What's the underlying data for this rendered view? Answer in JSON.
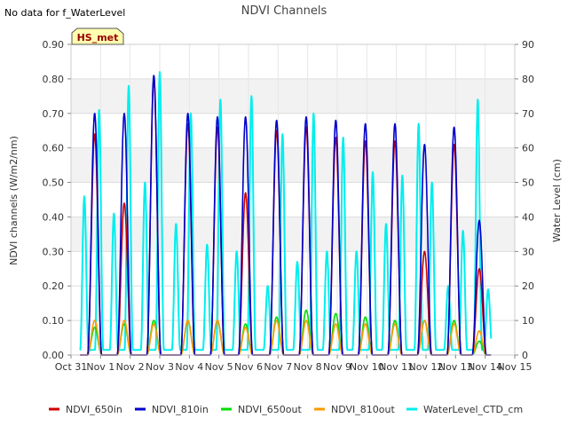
{
  "notice": "No data for f_WaterLevel",
  "site_badge": "HS_met",
  "chart_data": {
    "type": "line",
    "title": "NDVI Channels",
    "ylabel": "NDVI channels (W/m2/nm)",
    "ylabel_right": "Water Level (cm)",
    "x_ticks": [
      "Oct 31",
      "Nov 1",
      "Nov 2",
      "Nov 3",
      "Nov 4",
      "Nov 5",
      "Nov 6",
      "Nov 7",
      "Nov 8",
      "Nov 9",
      "Nov 10",
      "Nov 11",
      "Nov 12",
      "Nov 13",
      "Nov 14",
      "Nov 15"
    ],
    "xlim": [
      0,
      15
    ],
    "ylim": [
      0,
      0.9
    ],
    "y_ticks": [
      "0.00",
      "0.10",
      "0.20",
      "0.30",
      "0.40",
      "0.50",
      "0.60",
      "0.70",
      "0.80",
      "0.90"
    ],
    "ylim_right": [
      0,
      90
    ],
    "y_ticks_right": [
      "0",
      "10",
      "20",
      "30",
      "40",
      "50",
      "60",
      "70",
      "80",
      "90"
    ],
    "grid": true,
    "legend_position": "bottom",
    "series": [
      {
        "name": "NDVI_650in",
        "color": "#cc0000",
        "axis": "left",
        "peaks": [
          {
            "day": 0.8,
            "value": 0.64
          },
          {
            "day": 1.8,
            "value": 0.44
          },
          {
            "day": 2.8,
            "value": 0.8
          },
          {
            "day": 3.95,
            "value": 0.67
          },
          {
            "day": 4.95,
            "value": 0.66
          },
          {
            "day": 5.9,
            "value": 0.47
          },
          {
            "day": 6.95,
            "value": 0.65
          },
          {
            "day": 7.95,
            "value": 0.66
          },
          {
            "day": 8.95,
            "value": 0.63
          },
          {
            "day": 9.95,
            "value": 0.62
          },
          {
            "day": 10.95,
            "value": 0.62
          },
          {
            "day": 11.95,
            "value": 0.3
          },
          {
            "day": 12.95,
            "value": 0.61
          },
          {
            "day": 13.8,
            "value": 0.25
          }
        ]
      },
      {
        "name": "NDVI_810in",
        "color": "#0000cc",
        "axis": "left",
        "peaks": [
          {
            "day": 0.8,
            "value": 0.7
          },
          {
            "day": 1.8,
            "value": 0.7
          },
          {
            "day": 2.8,
            "value": 0.81
          },
          {
            "day": 3.95,
            "value": 0.7
          },
          {
            "day": 4.95,
            "value": 0.69
          },
          {
            "day": 5.9,
            "value": 0.69
          },
          {
            "day": 6.95,
            "value": 0.68
          },
          {
            "day": 7.95,
            "value": 0.69
          },
          {
            "day": 8.95,
            "value": 0.68
          },
          {
            "day": 9.95,
            "value": 0.67
          },
          {
            "day": 10.95,
            "value": 0.67
          },
          {
            "day": 11.95,
            "value": 0.61
          },
          {
            "day": 12.95,
            "value": 0.66
          },
          {
            "day": 13.8,
            "value": 0.39
          }
        ]
      },
      {
        "name": "NDVI_650out",
        "color": "#00dd00",
        "axis": "left",
        "peaks": [
          {
            "day": 0.8,
            "value": 0.08
          },
          {
            "day": 1.8,
            "value": 0.09
          },
          {
            "day": 2.8,
            "value": 0.1
          },
          {
            "day": 3.95,
            "value": 0.1
          },
          {
            "day": 4.95,
            "value": 0.1
          },
          {
            "day": 5.9,
            "value": 0.09
          },
          {
            "day": 6.95,
            "value": 0.11
          },
          {
            "day": 7.95,
            "value": 0.13
          },
          {
            "day": 8.95,
            "value": 0.12
          },
          {
            "day": 9.95,
            "value": 0.11
          },
          {
            "day": 10.95,
            "value": 0.1
          },
          {
            "day": 11.95,
            "value": 0.1
          },
          {
            "day": 12.95,
            "value": 0.1
          },
          {
            "day": 13.8,
            "value": 0.04
          }
        ]
      },
      {
        "name": "NDVI_810out",
        "color": "#ff9900",
        "axis": "left",
        "peaks": [
          {
            "day": 0.8,
            "value": 0.1
          },
          {
            "day": 1.8,
            "value": 0.1
          },
          {
            "day": 2.8,
            "value": 0.09
          },
          {
            "day": 3.95,
            "value": 0.1
          },
          {
            "day": 4.95,
            "value": 0.1
          },
          {
            "day": 5.9,
            "value": 0.08
          },
          {
            "day": 6.95,
            "value": 0.1
          },
          {
            "day": 7.95,
            "value": 0.1
          },
          {
            "day": 8.95,
            "value": 0.09
          },
          {
            "day": 9.95,
            "value": 0.09
          },
          {
            "day": 10.95,
            "value": 0.09
          },
          {
            "day": 11.95,
            "value": 0.1
          },
          {
            "day": 12.95,
            "value": 0.09
          },
          {
            "day": 13.8,
            "value": 0.07
          }
        ]
      },
      {
        "name": "WaterLevel_CTD_cm",
        "color": "#00eeee",
        "axis": "right",
        "peaks": [
          {
            "day": 0.45,
            "value": 46
          },
          {
            "day": 0.95,
            "value": 71
          },
          {
            "day": 1.45,
            "value": 41
          },
          {
            "day": 1.95,
            "value": 78
          },
          {
            "day": 2.5,
            "value": 50
          },
          {
            "day": 3.0,
            "value": 82
          },
          {
            "day": 3.55,
            "value": 38
          },
          {
            "day": 4.05,
            "value": 70
          },
          {
            "day": 4.6,
            "value": 32
          },
          {
            "day": 5.05,
            "value": 74
          },
          {
            "day": 5.6,
            "value": 30
          },
          {
            "day": 6.1,
            "value": 75
          },
          {
            "day": 6.65,
            "value": 20
          },
          {
            "day": 7.15,
            "value": 64
          },
          {
            "day": 7.65,
            "value": 27
          },
          {
            "day": 8.2,
            "value": 70
          },
          {
            "day": 8.65,
            "value": 30
          },
          {
            "day": 9.2,
            "value": 63
          },
          {
            "day": 9.65,
            "value": 30
          },
          {
            "day": 10.2,
            "value": 53
          },
          {
            "day": 10.65,
            "value": 38
          },
          {
            "day": 11.2,
            "value": 52
          },
          {
            "day": 11.75,
            "value": 67
          },
          {
            "day": 12.2,
            "value": 50
          },
          {
            "day": 12.75,
            "value": 20
          },
          {
            "day": 13.25,
            "value": 36
          },
          {
            "day": 13.75,
            "value": 74
          },
          {
            "day": 14.1,
            "value": 19
          }
        ]
      }
    ]
  }
}
